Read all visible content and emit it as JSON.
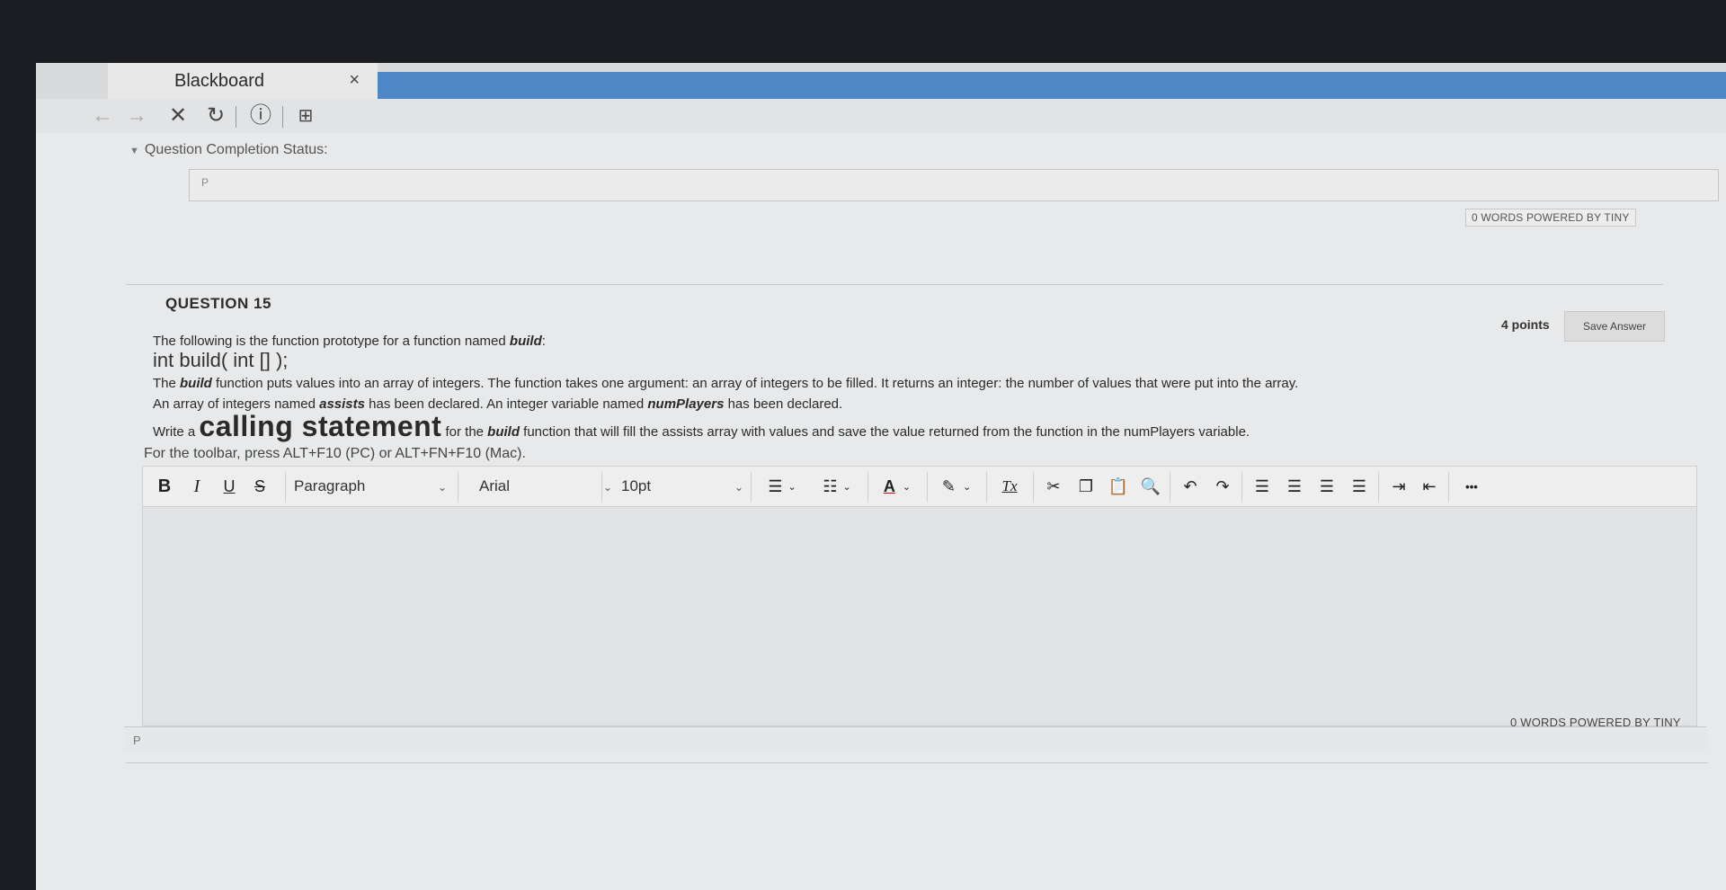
{
  "browser": {
    "tab_title": "Blackboard",
    "tab_close": "×",
    "nav": {
      "back": "←",
      "forward": "→",
      "stop": "✕",
      "reload": "↻",
      "info": "ⓘ",
      "page": "⊞"
    }
  },
  "status": {
    "label": "Question Completion Status:"
  },
  "prev_editor": {
    "path": "P",
    "words": "0 WORDS  POWERED BY TINY"
  },
  "question": {
    "title": "QUESTION 15",
    "points": "4 points",
    "save_label": "Save Answer",
    "line1_pre": "The following is the function prototype for a function named ",
    "line1_bold": "build",
    "line1_post": ":",
    "prototype": "int build( int [] );",
    "line3_pre": "The ",
    "line3_bold": "build",
    "line3_post": " function puts values into an array of integers. The function takes one argument: an array of integers to be filled. It returns an integer: the number of values that were put into the array.",
    "line4_pre": "An array of integers named ",
    "line4_bold1": "assists",
    "line4_mid": " has been declared. An integer variable named ",
    "line4_bold2": "numPlayers",
    "line4_post": " has been declared.",
    "line5_pre": "Write a ",
    "line5_big": "calling statement",
    "line5_mid": " for the ",
    "line5_bold": "build",
    "line5_post": " function that will fill the assists array with values and save the value returned from the function in the numPlayers variable."
  },
  "editor": {
    "hint": "For the toolbar, press ALT+F10 (PC) or ALT+FN+F10 (Mac).",
    "bold": "B",
    "italic": "I",
    "underline": "U",
    "strike": "S",
    "block_format": "Paragraph",
    "font_family": "Arial",
    "font_size": "10pt",
    "text_color_icon": "A",
    "clear_format_icon": "Tx",
    "more": "•••",
    "path": "P",
    "words": "0 WORDS  POWERED BY TINY"
  }
}
